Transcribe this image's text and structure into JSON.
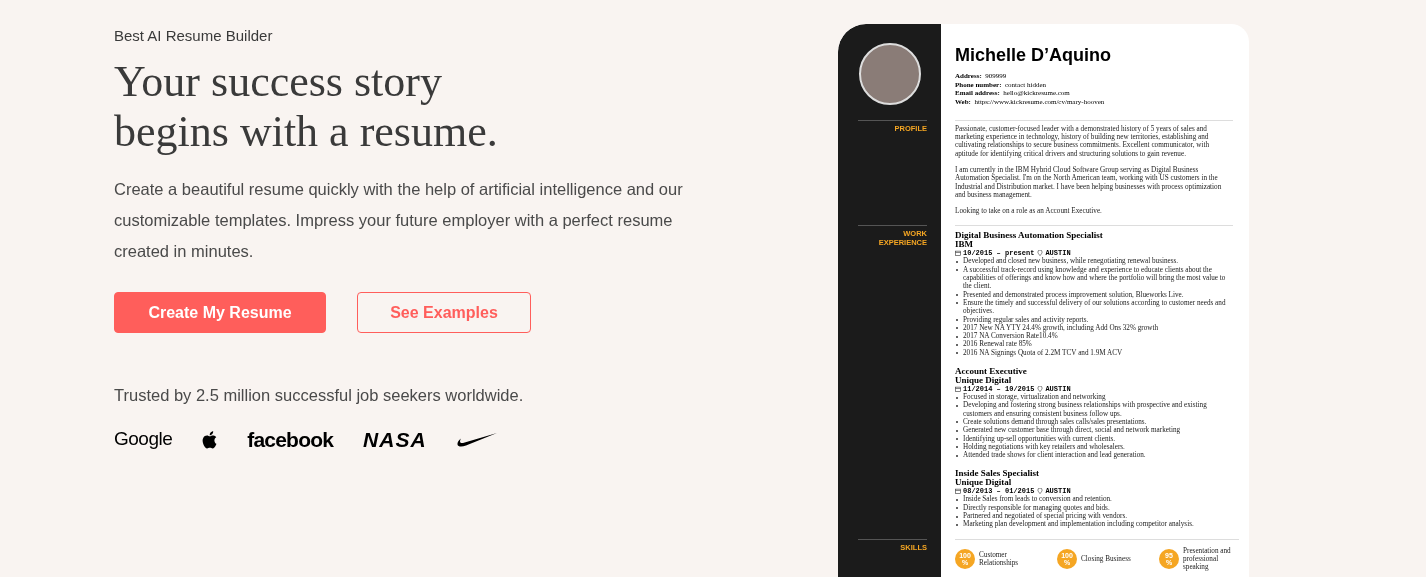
{
  "hero": {
    "eyebrow": "Best AI Resume Builder",
    "headline": [
      "Your success story",
      "begins with a resume."
    ],
    "description": "Create a beautiful resume quickly with the help of artificial intelligence and our customizable templates. Impress your future employer with a perfect resume created in minutes.",
    "buttons": [
      {
        "label": "Create My Resume",
        "kind": "primary"
      },
      {
        "label": "See Examples",
        "kind": "outline"
      }
    ],
    "trust_text": "Trusted by 2.5 million successful job seekers worldwide.",
    "logos": [
      {
        "kind": "wordmark",
        "text": "Google"
      },
      {
        "kind": "apple"
      },
      {
        "kind": "wordmark-bold",
        "text": "facebook"
      },
      {
        "kind": "nasa",
        "text": "NASA"
      },
      {
        "kind": "nike"
      }
    ]
  },
  "resume": {
    "name": "Michelle D’Aquino",
    "contact": [
      {
        "label": "Address:",
        "value": "909999"
      },
      {
        "label": "Phone number:",
        "value": "contact hidden"
      },
      {
        "label": "Email address:",
        "value": "hello@kickresume.com"
      },
      {
        "label": "Web:",
        "value": "https://www.kickresume.com/cv/mary-hooven"
      }
    ],
    "sections": [
      {
        "kind": "profile",
        "title": "PROFILE",
        "paragraphs": [
          "Passionate, customer-focused leader with a demonstrated history of 5 years of sales and marketing experience in technology, history of building new territories, establishing and cultivating relationships to secure business commitments. Excellent communicator, with aptitude for identifying critical drivers and structuring solutions to gain revenue.",
          "I am currently in the IBM Hybrid Cloud Software Group serving as Digital Business Automation Specialist. I'm on the North American team, working with US customers in the Industrial and Distribution market. I have been helping businesses with process optimization and business management.",
          "Looking to take on a role as an Account Executive."
        ]
      },
      {
        "kind": "work",
        "title": "WORK EXPERIENCE",
        "jobs": [
          {
            "title": "Digital Business Automation Specialist",
            "company": "IBM",
            "dates": "10/2015 – present",
            "location": "AUSTIN",
            "bullets": [
              "Developed and closed new business, while renegotiating renewal business.",
              "A successful track-record using knowledge and experience  to educate clients about the capabilities of offerings and know how and where the portfolio will bring the most value to the client.",
              "Presented and demonstrated process improvement solution, Blueworks Live.",
              "Ensure the timely and successful delivery of our solutions according to customer needs and objectives.",
              "Providing regular sales and activity reports.",
              "2017 New NA YTY 24.4% growth, including Add Ons 32% growth",
              "2017 NA Conversion Rate10.4%",
              "2016 Renewal rate 85%",
              "2016 NA Signings Quota of 2.2M TCV and 1.9M ACV"
            ]
          },
          {
            "title": "Account Executive",
            "company": "Unique Digital",
            "dates": "11/2014 – 10/2015",
            "location": "AUSTIN",
            "bullets": [
              "Focused in storage, virtualization and networking",
              "Developing and fostering strong business relationships with prospective and existing customers and ensuring consistent business follow ups.",
              "Create solutions demand through sales calls/sales presentations.",
              "Generated new customer base through direct, social and network marketing",
              "Identifying up-sell opportunities with current clients.",
              "Holding negotiations with key retailers and wholesalers.",
              "Attended trade shows for client interaction and lead generation."
            ]
          },
          {
            "title": "Inside Sales Specialist",
            "company": "Unique Digital",
            "dates": "08/2013 – 01/2015",
            "location": "AUSTIN",
            "bullets": [
              "Inside Sales from leads to conversion and retention.",
              "Directly responsible for managing quotes and bids.",
              "Partnered and negotiated of special pricing with vendors.",
              "Marketing plan development and implementation including competitor analysis."
            ]
          }
        ]
      },
      {
        "kind": "skills",
        "title": "SKILLS",
        "skills": [
          {
            "value": "100",
            "unit": "%",
            "label": "Customer Relationships"
          },
          {
            "value": "100",
            "unit": "%",
            "label": "Closing Business"
          },
          {
            "value": "95",
            "unit": "%",
            "label": "Presentation and professional speaking"
          }
        ]
      }
    ]
  }
}
